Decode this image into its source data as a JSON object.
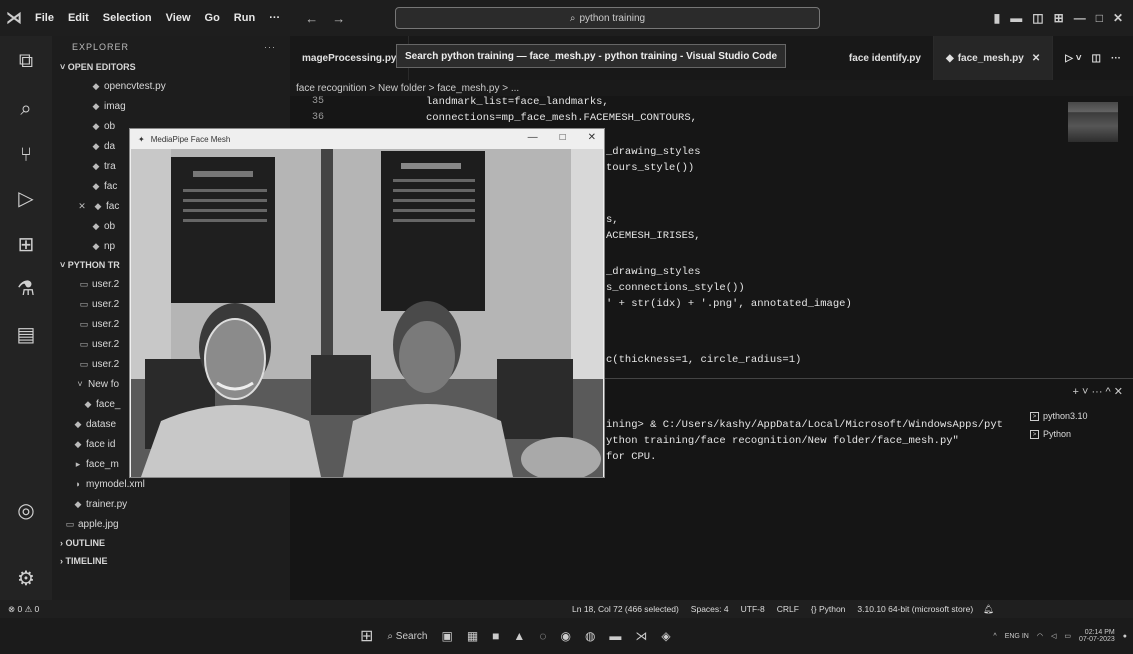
{
  "titlebar": {
    "menus": [
      "File",
      "Edit",
      "Selection",
      "View",
      "Go",
      "Run",
      "···"
    ],
    "search_text": "python training"
  },
  "tooltip": "Search python training — face_mesh.py - python training - Visual Studio Code",
  "sidebar": {
    "header": "EXPLORER",
    "open_editors_label": "OPEN EDITORS",
    "open_editors": [
      "opencvtest.py",
      "imag",
      "ob",
      "da",
      "tra",
      "fac",
      "fac",
      "ob",
      "np"
    ],
    "project_label": "PYTHON TR",
    "project_items": [
      "user.2",
      "user.2",
      "user.2",
      "user.2",
      "user.2",
      "New fo",
      "face_",
      "datase",
      "face id",
      "face_m",
      "mymodel.xml",
      "trainer.py",
      "apple.jpg"
    ],
    "outline_label": "OUTLINE",
    "timeline_label": "TIMELINE"
  },
  "tabs": {
    "left": "mageProcessing.py",
    "right1": "face identify.py",
    "active": "face_mesh.py"
  },
  "breadcrumb": "face recognition > New folder > face_mesh.py > ...",
  "editor": {
    "line_numbers": [
      "35",
      "36"
    ],
    "lines": [
      "landmark_list=face_landmarks,",
      "connections=mp_face_mesh.FACEMESH_CONTOURS,",
      "_drawing_styles",
      "tours_style())",
      "s,",
      "ACEMESH_IRISES,",
      "_drawing_styles",
      "s_connections_style())",
      "' + str(idx) + '.png', annotated_image)",
      "c(thickness=1, circle_radius=1)"
    ]
  },
  "terminal": {
    "lines": [
      "ining> & C:/Users/kashy/AppData/Local/Microsoft/WindowsApps/pyt",
      "ython training/face recognition/New folder/face_mesh.py\"",
      "for CPU."
    ],
    "instances": [
      "python3.10",
      "Python"
    ],
    "tools": "+ ˅ ··· ^ ✕"
  },
  "mediapipe": {
    "title": "MediaPipe Face Mesh"
  },
  "statusbar": {
    "left": "⊗ 0 ⚠ 0",
    "position": "Ln 18, Col 72 (466 selected)",
    "spaces": "Spaces: 4",
    "encoding": "UTF-8",
    "eol": "CRLF",
    "language": "{} Python",
    "interpreter": "3.10.10 64-bit (microsoft store)"
  },
  "taskbar": {
    "search": "Search",
    "lang": "ENG IN",
    "time": "02:14 PM",
    "date": "07-07-2023"
  },
  "colors": {
    "editor_bg": "#161616",
    "sidebar_bg": "#1d1d1d",
    "mp_window": "#efefef"
  }
}
